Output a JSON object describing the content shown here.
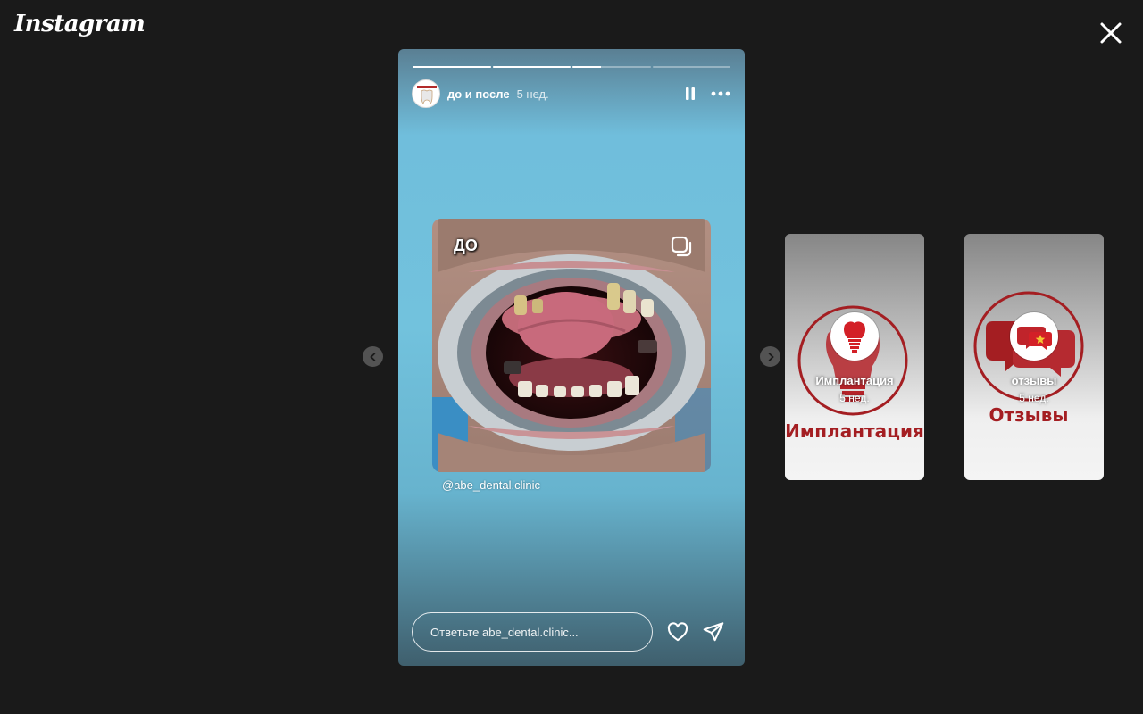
{
  "app": {
    "logo": "Instagram"
  },
  "story": {
    "username": "до и после",
    "time": "5 нед.",
    "progress": [
      1.0,
      1.0,
      0.37,
      0.0
    ],
    "photo_label": "ДО",
    "handle": "@abe_dental.clinic",
    "reply_placeholder": "Ответьте abe_dental.clinic..."
  },
  "highlights": [
    {
      "name": "Имплантация",
      "time": "5 нед.",
      "title_big": "Имплантация"
    },
    {
      "name": "отзывы",
      "time": "5 нед.",
      "title_big": "Отзывы"
    }
  ],
  "colors": {
    "background": "#1a1a1a",
    "brand_red": "#a41e22",
    "story_blue": "#72c2dd"
  },
  "icons": [
    "close-icon",
    "pause-icon",
    "more-icon",
    "heart-icon",
    "send-icon",
    "chevron-left-icon",
    "chevron-right-icon",
    "multi-photo-icon"
  ]
}
